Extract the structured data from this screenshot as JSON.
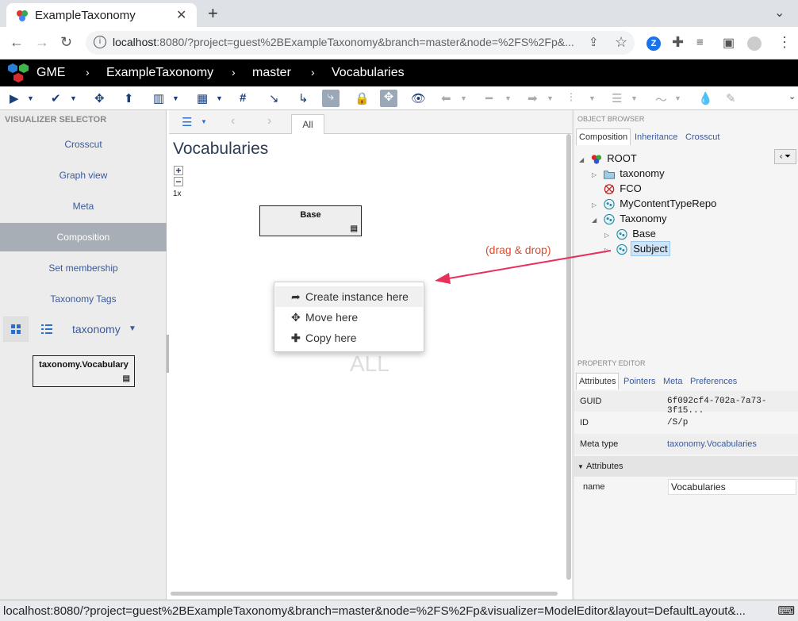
{
  "browser": {
    "tab_title": "ExampleTaxonomy",
    "url_host": "localhost",
    "url_rest": ":8080/?project=guest%2BExampleTaxonomy&branch=master&node=%2FS%2Fp&..."
  },
  "header": {
    "app_name": "GME",
    "project": "ExampleTaxonomy",
    "branch": "master",
    "node": "Vocabularies"
  },
  "visualizer_selector": {
    "title": "VISUALIZER SELECTOR",
    "items": [
      "Crosscut",
      "Graph view",
      "Meta",
      "Composition",
      "Set membership",
      "Taxonomy Tags"
    ],
    "active": "Composition"
  },
  "part_browser": {
    "library": "taxonomy",
    "items": [
      "taxonomy.Vocabulary"
    ]
  },
  "editor": {
    "tab": "All",
    "title": "Vocabularies",
    "zoom_plus": "+",
    "zoom_minus": "−",
    "zoom_level": "1x",
    "node_base": "Base",
    "aspect_watermark": "ALL",
    "context_menu": [
      "Create instance here",
      "Move here",
      "Copy here"
    ]
  },
  "annotation": "(drag & drop)",
  "object_browser": {
    "title": "OBJECT BROWSER",
    "tabs": [
      "Composition",
      "Inheritance",
      "Crosscut"
    ],
    "tree": [
      "ROOT",
      "taxonomy",
      "FCO",
      "MyContentTypeRepo",
      "Taxonomy",
      "Base",
      "Subject"
    ],
    "selected": "Subject"
  },
  "property_editor": {
    "title": "PROPERTY EDITOR",
    "tabs": [
      "Attributes",
      "Pointers",
      "Meta",
      "Preferences"
    ],
    "guid_label": "GUID",
    "guid_value": "6f092cf4-702a-7a73-3f15...",
    "id_label": "ID",
    "id_value": "/S/p",
    "metatype_label": "Meta type",
    "metatype_value": "taxonomy.Vocabularies",
    "section": "Attributes",
    "name_label": "name",
    "name_value": "Vocabularies"
  },
  "statusbar": {
    "url": "localhost:8080/?project=guest%2BExampleTaxonomy&branch=master&node=%2FS%2Fp&visualizer=ModelEditor&layout=DefaultLayout&..."
  }
}
